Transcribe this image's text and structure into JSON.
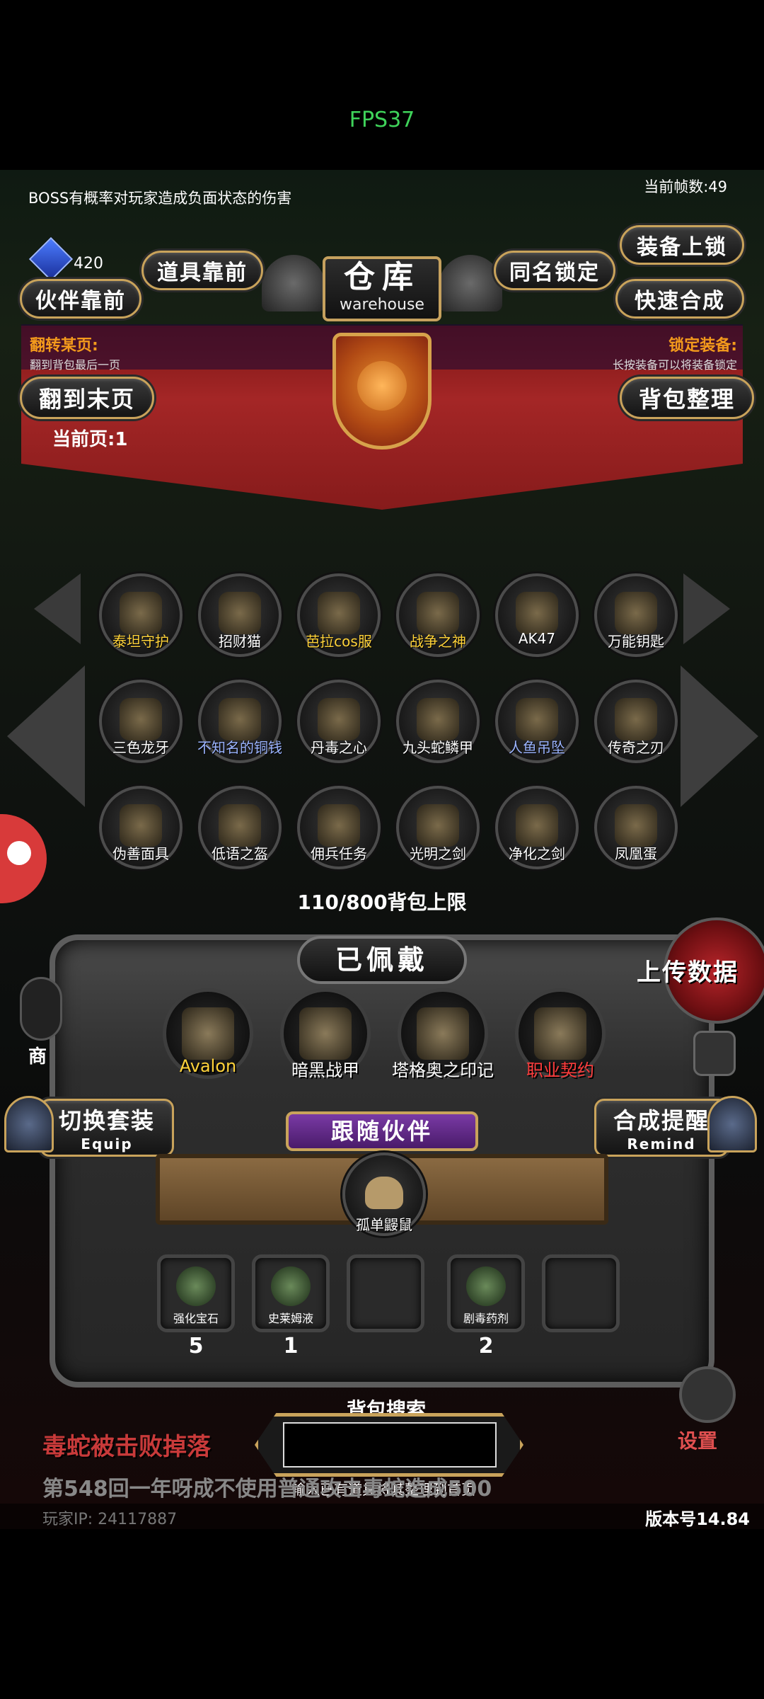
{
  "status": {
    "fps": "FPS37"
  },
  "game": {
    "notice": "BOSS有概率对玩家造成负面状态的伤害",
    "frame_count": "当前帧数:49",
    "gem_count": "420",
    "buttons": {
      "items_first": "道具靠前",
      "partners_first": "伙伴靠前",
      "same_name_lock": "同名锁定",
      "equip_lock": "装备上锁",
      "quick_merge": "快速合成",
      "go_last_page": "翻到末页",
      "sort_bag": "背包整理",
      "switch_set": "切换套装",
      "switch_set_sub": "Equip",
      "merge_remind": "合成提醒",
      "merge_remind_sub": "Remind",
      "upload": "上传数据",
      "settings": "设置"
    },
    "warehouse": {
      "title": "仓库",
      "subtitle": "warehouse"
    },
    "flip_hint": {
      "label": "翻转某页:",
      "desc": "翻到背包最后一页"
    },
    "lock_hint": {
      "label": "锁定装备:",
      "desc": "长按装备可以将装备锁定"
    },
    "current_page": "当前页:1",
    "items": [
      {
        "name": "泰坦守护",
        "color": "gold",
        "icon": "titan-armor-icon"
      },
      {
        "name": "招财猫",
        "color": "white",
        "icon": "lucky-cat-icon"
      },
      {
        "name": "芭拉cos服",
        "color": "gold",
        "icon": "costume-icon"
      },
      {
        "name": "战争之神",
        "color": "gold",
        "icon": "war-god-icon"
      },
      {
        "name": "AK47",
        "color": "white",
        "icon": "rifle-icon"
      },
      {
        "name": "万能钥匙",
        "color": "white",
        "icon": "key-icon"
      },
      {
        "name": "三色龙牙",
        "color": "white",
        "icon": "dragon-fang-icon"
      },
      {
        "name": "不知名的铜钱",
        "color": "blue",
        "icon": "coin-icon"
      },
      {
        "name": "丹毒之心",
        "color": "white",
        "icon": "snake-heart-icon"
      },
      {
        "name": "九头蛇鳞甲",
        "color": "white",
        "icon": "hydra-armor-icon"
      },
      {
        "name": "人鱼吊坠",
        "color": "blue",
        "icon": "pendant-icon"
      },
      {
        "name": "传奇之刃",
        "color": "white",
        "icon": "legend-blade-icon"
      },
      {
        "name": "伪善面具",
        "color": "white",
        "icon": "mask-icon"
      },
      {
        "name": "低语之盔",
        "color": "white",
        "icon": "helmet-icon"
      },
      {
        "name": "佣兵任务",
        "color": "white",
        "icon": "scroll-horn-icon"
      },
      {
        "name": "光明之剑",
        "color": "white",
        "icon": "light-sword-icon"
      },
      {
        "name": "净化之剑",
        "color": "white",
        "icon": "purify-sword-icon"
      },
      {
        "name": "凤凰蛋",
        "color": "white",
        "icon": "egg-icon"
      }
    ],
    "capacity": "110/800背包上限",
    "equipped": {
      "title": "已佩戴",
      "slots": [
        {
          "name": "Avalon",
          "color": "gold",
          "icon": "avalon-lance-icon"
        },
        {
          "name": "暗黑战甲",
          "color": "white",
          "icon": "dark-armor-icon"
        },
        {
          "name": "塔格奥之印记",
          "color": "white",
          "icon": "skull-chef-icon"
        },
        {
          "name": "职业契约",
          "color": "red",
          "icon": "contract-scroll-icon"
        }
      ]
    },
    "partner": {
      "title": "跟随伙伴",
      "name": "孤单鼹鼠",
      "icon": "mole-icon"
    },
    "consumables": [
      {
        "name": "强化宝石",
        "count": "5",
        "icon": "green-gem-icon"
      },
      {
        "name": "史莱姆液",
        "count": "1",
        "icon": "potion-icon"
      },
      {
        "name": "",
        "count": "",
        "icon": ""
      },
      {
        "name": "剧毒药剂",
        "count": "2",
        "icon": "poison-flask-icon"
      },
      {
        "name": "",
        "count": "",
        "icon": ""
      }
    ],
    "search": {
      "title": "背包搜索",
      "hint": "输入已有道具将其整理到首页",
      "value": ""
    },
    "drop_message": "毒蛇被击败掉落",
    "scroll_message": "第548回一年呀成不使用普通攻击毒蛇造成500",
    "player_ip": "玩家IP: 24117887",
    "version": "版本号14.84",
    "shop_label": "商",
    "colors": {
      "gold": "#ffd33a",
      "blue": "#9bb4ff",
      "red": "#ff3b3b",
      "accent_green": "#3fd35a"
    }
  }
}
